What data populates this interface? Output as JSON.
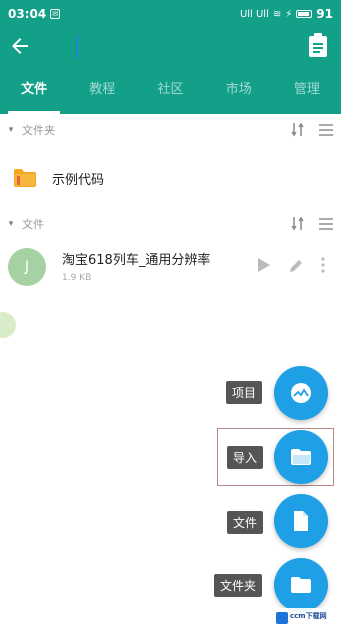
{
  "status_bar": {
    "time": "03:04",
    "battery": "91",
    "signal_text": "Ull Ull"
  },
  "app_bar": {
    "title_placeholder": ""
  },
  "tabs": [
    {
      "label": "文件",
      "active": true
    },
    {
      "label": "教程",
      "active": false
    },
    {
      "label": "社区",
      "active": false
    },
    {
      "label": "市场",
      "active": false
    },
    {
      "label": "管理",
      "active": false
    }
  ],
  "sections": {
    "folders": {
      "title": "文件夹"
    },
    "files": {
      "title": "文件"
    }
  },
  "folder_items": [
    {
      "name": "示例代码"
    }
  ],
  "file_items": [
    {
      "avatar_letter": "J",
      "name": "淘宝618列车_通用分辨率",
      "size": "1.9 KB"
    }
  ],
  "fab_menu": [
    {
      "label": "项目",
      "icon": "project-icon"
    },
    {
      "label": "导入",
      "icon": "folder-open-icon"
    },
    {
      "label": "文件",
      "icon": "file-icon"
    },
    {
      "label": "文件夹",
      "icon": "folder-icon"
    }
  ],
  "watermark": {
    "text": "ccm下载网"
  },
  "colors": {
    "primary": "#13a089",
    "fab": "#1e9fe6",
    "folder": "#f5a623"
  }
}
